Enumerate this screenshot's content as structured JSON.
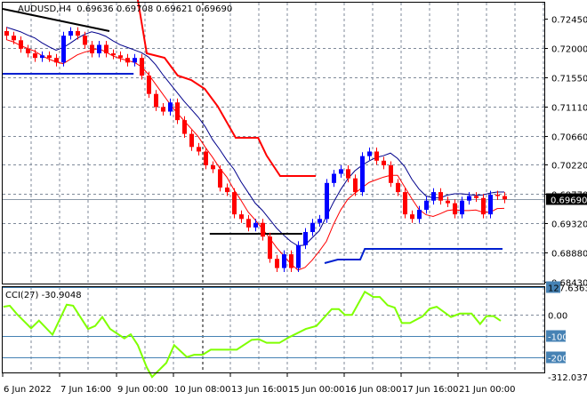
{
  "header": {
    "symbol": "AUDUSD,H4",
    "ohlc": "0.69636 0.69708 0.69621 0.69690"
  },
  "current_price": "0.69690",
  "cci_header": "CCI(27) -30.9048",
  "colors": {
    "bull": "#0000ff",
    "bear": "#ff0000",
    "cci": "#7fff00",
    "grid": "#7f8a99",
    "level": "#4682b4",
    "step_red": "#ff0000",
    "step_blue": "#0020d0",
    "line_black": "#000000"
  },
  "chart_data": {
    "type": "candlestick",
    "title": "AUDUSD,H4",
    "price_ticks": [
      "0.72450",
      "0.72000",
      "0.71550",
      "0.71110",
      "0.70660",
      "0.70220",
      "0.69770",
      "0.69320",
      "0.68880",
      "0.68430"
    ],
    "ylim": [
      0.6843,
      0.7245
    ],
    "time_labels": [
      "6 Jun 2022",
      "7 Jun 16:00",
      "9 Jun 00:00",
      "10 Jun 08:00",
      "13 Jun 16:00",
      "15 Jun 00:00",
      "16 Jun 08:00",
      "17 Jun 16:00",
      "21 Jun 00:00"
    ],
    "first_open": 0.7226,
    "wick": 0.0006,
    "closes": [
      0.7219,
      0.7212,
      0.7199,
      0.7192,
      0.7185,
      0.7189,
      0.7185,
      0.7178,
      0.7219,
      0.7226,
      0.7219,
      0.7205,
      0.7192,
      0.7205,
      0.7192,
      0.7189,
      0.7185,
      0.7178,
      0.7185,
      0.7158,
      0.713,
      0.711,
      0.7103,
      0.7117,
      0.709,
      0.7069,
      0.7049,
      0.7042,
      0.7021,
      0.7015,
      0.6987,
      0.698,
      0.6946,
      0.6939,
      0.6926,
      0.6933,
      0.6912,
      0.6878,
      0.6864,
      0.6885,
      0.6864,
      0.6899,
      0.6919,
      0.6933,
      0.6939,
      0.6994,
      0.7008,
      0.7015,
      0.7001,
      0.698,
      0.7035,
      0.7042,
      0.7028,
      0.7021,
      0.6994,
      0.698,
      0.6946,
      0.6939,
      0.6953,
      0.6967,
      0.698,
      0.6967,
      0.6963,
      0.6946,
      0.6967,
      0.6974,
      0.6971,
      0.6946,
      0.6976,
      0.6974,
      0.6969
    ],
    "overlays": {
      "red_step": [
        [
          18.5,
          0.72735
        ],
        [
          19.75,
          0.7192
        ],
        [
          22.25,
          0.71852
        ],
        [
          24.1,
          0.71581
        ],
        [
          26,
          0.71513
        ],
        [
          27.9,
          0.71377
        ],
        [
          29.75,
          0.71106
        ],
        [
          32.25,
          0.7063
        ],
        [
          35.4,
          0.7063
        ],
        [
          36.6,
          0.70358
        ],
        [
          38.5,
          0.70046
        ],
        [
          43.5,
          0.70046
        ]
      ],
      "blue_step": [
        [
          44.75,
          0.68715
        ],
        [
          46.6,
          0.68769
        ],
        [
          49.75,
          0.68769
        ],
        [
          50.4,
          0.68932
        ],
        [
          69.75,
          0.68932
        ]
      ],
      "blue_horizontal": [
        [
          -0.5,
          0.71608
        ],
        [
          17.9,
          0.71608
        ]
      ],
      "black_trendline": [
        [
          -0.5,
          0.72599
        ],
        [
          14.5,
          0.7226
        ]
      ],
      "black_horizontal": [
        [
          28.6,
          0.69163
        ],
        [
          41.6,
          0.69163
        ]
      ]
    },
    "cci": {
      "name": "CCI(27)",
      "levels": [
        127.6363,
        0,
        -100,
        -200
      ],
      "level_labels": [
        "127.6363",
        "0.00",
        "-100",
        "-200",
        "-312.0378"
      ],
      "points": [
        [
          -0.4,
          37
        ],
        [
          0.5,
          42
        ],
        [
          1.5,
          3
        ],
        [
          3.5,
          -64
        ],
        [
          4.6,
          -28
        ],
        [
          6.5,
          -94
        ],
        [
          8.5,
          47
        ],
        [
          9.4,
          42
        ],
        [
          11.5,
          -67
        ],
        [
          12.5,
          -53
        ],
        [
          13.5,
          -11
        ],
        [
          14.6,
          -67
        ],
        [
          16.6,
          -111
        ],
        [
          17.5,
          -92
        ],
        [
          18.5,
          -143
        ],
        [
          19.75,
          -247
        ],
        [
          20.5,
          -292
        ],
        [
          22.5,
          -226
        ],
        [
          23.6,
          -143
        ],
        [
          25.4,
          -199
        ],
        [
          26.4,
          -188
        ],
        [
          27.6,
          -188
        ],
        [
          28.75,
          -164
        ],
        [
          30.75,
          -164
        ],
        [
          32.4,
          -164
        ],
        [
          34.5,
          -118
        ],
        [
          35.5,
          -115
        ],
        [
          36.6,
          -132
        ],
        [
          38.4,
          -132
        ],
        [
          39.75,
          -106
        ],
        [
          42.1,
          -67
        ],
        [
          43.6,
          -53
        ],
        [
          45.75,
          26
        ],
        [
          46.75,
          26
        ],
        [
          47.6,
          -1
        ],
        [
          48.6,
          -1
        ],
        [
          50.4,
          107
        ],
        [
          51.6,
          83
        ],
        [
          52.5,
          83
        ],
        [
          53.6,
          44
        ],
        [
          54.6,
          33
        ],
        [
          55.6,
          -39
        ],
        [
          56.75,
          -39
        ],
        [
          58.5,
          -8
        ],
        [
          59.5,
          28
        ],
        [
          60.5,
          37
        ],
        [
          62.5,
          -11
        ],
        [
          63.75,
          5
        ],
        [
          65.4,
          5
        ],
        [
          66.6,
          -44
        ],
        [
          67.5,
          -7
        ],
        [
          68.5,
          -7
        ],
        [
          69.5,
          -29
        ]
      ]
    }
  }
}
